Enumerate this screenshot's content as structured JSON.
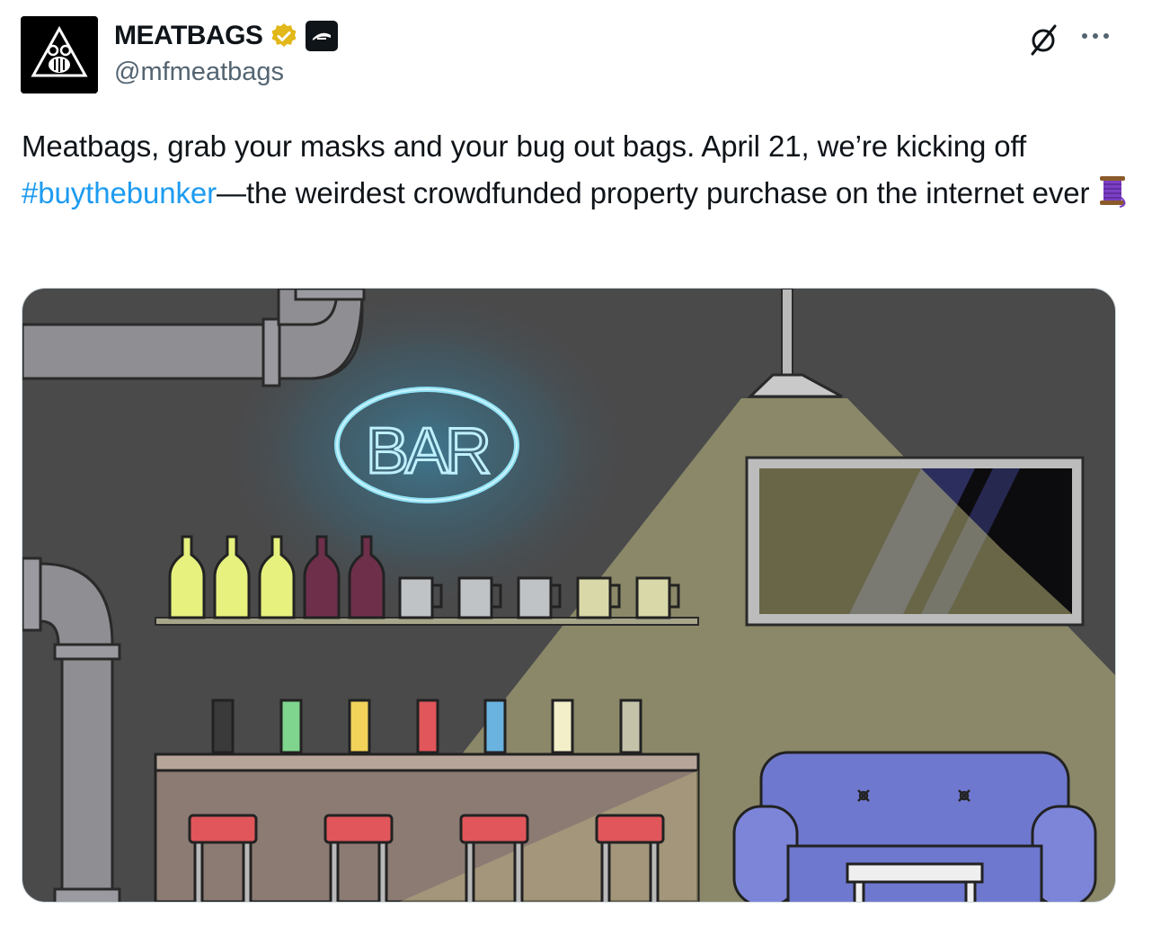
{
  "author": {
    "display_name": "MEATBAGS",
    "handle": "@mfmeatbags",
    "avatar_icon": "robot-skull-logo-icon",
    "verified_badge_icon": "gold-checkmark-badge-icon",
    "affiliate_badge_icon": "affiliate-logo-badge-icon"
  },
  "actions": {
    "grok_icon": "grok-icon",
    "more_icon": "more-options-icon"
  },
  "tweet": {
    "text_before": "Meatbags, grab your masks and your bug out bags. April 21, we’re kicking off ",
    "hashtag": "#buythebunker",
    "text_after": "—the weirdest crowdfunded property purchase on the internet ever",
    "emoji": "thread-spool-emoji"
  },
  "media": {
    "alt_description": "",
    "neon_sign_text": "BAR"
  },
  "colors": {
    "link": "#1d9bf0",
    "text": "#0f1419",
    "secondary": "#536471",
    "verified_gold": "#e2b719"
  }
}
